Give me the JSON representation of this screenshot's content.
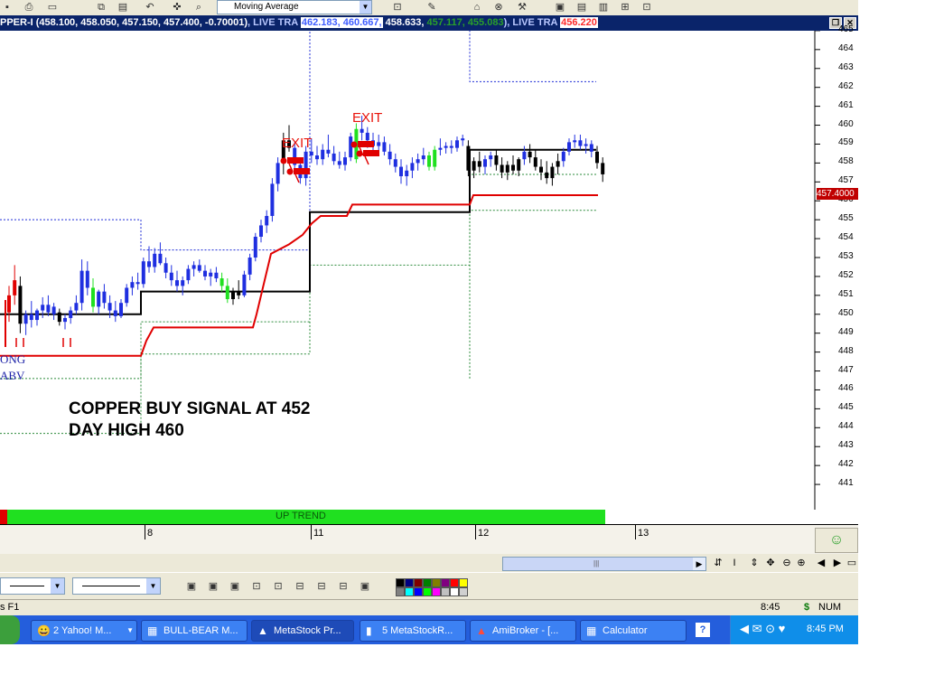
{
  "toolbar": {
    "indicator_value": "Moving Average",
    "buttons": [
      "save-icon",
      "print-icon",
      "copy-icon",
      "paste-icon",
      "undo-icon",
      "crosshair-icon",
      "zoom-icon"
    ],
    "right_buttons": [
      "tile-icon",
      "windows-icon",
      "split-icon",
      "grid-icon",
      "layout-icon"
    ]
  },
  "title_bar": {
    "prefix": "PPER-I",
    "ohlc": "(458.100, 458.050, 457.150, 457.400, -0.70001)",
    "sep1": ", LIVE TRA",
    "live1_a": "462.183, 460.667,",
    "live1_b": "458.633,",
    "live1_c": "457.117, 455.083",
    "sep2": "), LIVE TRA",
    "live2": "456.220",
    "colors": {
      "a": "#3d5cff",
      "b": "#ffffff",
      "c": "#2aa02a",
      "d": "#ff4a4a"
    }
  },
  "chart_data": {
    "type": "candlestick",
    "title": "COPPER BUY SIGNAL AT 452",
    "subtitle": "DAY HIGH 460",
    "annotations": [
      "EXIT",
      "EXIT"
    ],
    "left_text": [
      "ONG",
      "ABV"
    ],
    "ylim": [
      440.5,
      466.2
    ],
    "yticks": [
      441,
      442,
      443,
      444,
      445,
      446,
      447,
      448,
      449,
      450,
      451,
      452,
      453,
      454,
      455,
      456,
      457,
      458,
      459,
      460,
      461,
      462,
      463,
      464,
      465
    ],
    "last_price": "457.4000",
    "x_labels": [
      "8",
      "11",
      "12",
      "13"
    ],
    "candles": [
      [
        450.1,
        451.5,
        449.6,
        451.0,
        "r"
      ],
      [
        451.0,
        452.6,
        450.5,
        451.8,
        "r"
      ],
      [
        451.5,
        452.0,
        449.0,
        449.5,
        "k"
      ],
      [
        449.5,
        450.2,
        448.9,
        450.0,
        "b"
      ],
      [
        450.0,
        450.7,
        449.3,
        449.7,
        "b"
      ],
      [
        449.7,
        450.3,
        449.4,
        450.2,
        "b"
      ],
      [
        450.2,
        450.9,
        449.8,
        450.5,
        "b"
      ],
      [
        450.5,
        451.0,
        449.9,
        450.1,
        "b"
      ],
      [
        450.0,
        450.6,
        449.7,
        450.4,
        "b"
      ],
      [
        450.1,
        450.3,
        449.4,
        449.6,
        "k"
      ],
      [
        449.6,
        450.0,
        449.2,
        449.8,
        "b"
      ],
      [
        449.8,
        450.4,
        449.5,
        450.2,
        "b"
      ],
      [
        450.2,
        451.0,
        450.0,
        450.6,
        "b"
      ],
      [
        450.6,
        452.9,
        450.2,
        452.3,
        "b"
      ],
      [
        452.3,
        452.8,
        451.0,
        451.4,
        "b"
      ],
      [
        451.4,
        451.9,
        450.1,
        450.4,
        "g"
      ],
      [
        450.4,
        451.3,
        450.0,
        451.2,
        "b"
      ],
      [
        451.2,
        451.6,
        450.3,
        450.6,
        "b"
      ],
      [
        450.6,
        451.0,
        449.8,
        450.2,
        "b"
      ],
      [
        450.2,
        450.7,
        449.6,
        449.9,
        "b"
      ],
      [
        449.9,
        450.8,
        449.8,
        450.6,
        "b"
      ],
      [
        450.6,
        451.6,
        450.4,
        451.4,
        "b"
      ],
      [
        451.4,
        452.0,
        451.0,
        451.7,
        "b"
      ],
      [
        451.7,
        452.2,
        451.3,
        451.6,
        "b"
      ],
      [
        451.6,
        453.0,
        451.4,
        452.8,
        "b"
      ],
      [
        452.8,
        453.6,
        452.2,
        452.5,
        "b"
      ],
      [
        452.5,
        453.5,
        452.2,
        453.2,
        "b"
      ],
      [
        453.2,
        453.8,
        452.6,
        452.7,
        "b"
      ],
      [
        452.7,
        453.0,
        451.9,
        452.2,
        "b"
      ],
      [
        452.2,
        452.6,
        451.5,
        451.8,
        "b"
      ],
      [
        451.8,
        452.3,
        451.2,
        451.5,
        "b"
      ],
      [
        451.5,
        452.0,
        451.0,
        451.8,
        "b"
      ],
      [
        451.8,
        452.6,
        451.6,
        452.4,
        "b"
      ],
      [
        452.4,
        452.8,
        452.0,
        452.6,
        "b"
      ],
      [
        452.6,
        452.9,
        452.2,
        452.3,
        "b"
      ],
      [
        452.3,
        452.6,
        451.8,
        452.0,
        "b"
      ],
      [
        452.0,
        452.4,
        451.5,
        452.2,
        "b"
      ],
      [
        452.2,
        452.5,
        451.7,
        451.9,
        "b"
      ],
      [
        451.9,
        452.2,
        451.2,
        451.5,
        "g"
      ],
      [
        451.5,
        451.9,
        450.6,
        450.8,
        "g"
      ],
      [
        450.8,
        451.4,
        450.5,
        451.2,
        "k"
      ],
      [
        451.2,
        451.8,
        450.8,
        451.0,
        "k"
      ],
      [
        451.0,
        452.3,
        450.9,
        452.1,
        "b"
      ],
      [
        452.1,
        453.2,
        451.8,
        453.0,
        "b"
      ],
      [
        453.0,
        454.3,
        452.8,
        454.1,
        "b"
      ],
      [
        454.1,
        455.0,
        453.8,
        454.7,
        "b"
      ],
      [
        454.7,
        455.5,
        454.3,
        455.2,
        "b"
      ],
      [
        455.2,
        457.2,
        454.9,
        456.9,
        "b"
      ],
      [
        456.9,
        458.3,
        456.5,
        458.0,
        "b"
      ],
      [
        458.0,
        459.6,
        457.4,
        459.2,
        "k"
      ],
      [
        459.2,
        460.0,
        458.6,
        458.8,
        "k"
      ],
      [
        458.8,
        459.1,
        457.6,
        457.9,
        "b"
      ],
      [
        457.9,
        458.2,
        456.9,
        457.2,
        "b"
      ],
      [
        457.2,
        458.9,
        456.8,
        458.6,
        "b"
      ],
      [
        458.6,
        459.3,
        458.0,
        458.4,
        "b"
      ],
      [
        458.4,
        458.9,
        457.9,
        458.2,
        "b"
      ],
      [
        458.2,
        459.0,
        457.9,
        458.7,
        "b"
      ],
      [
        458.7,
        459.5,
        458.3,
        458.5,
        "b"
      ],
      [
        458.5,
        458.9,
        457.9,
        458.1,
        "b"
      ],
      [
        458.1,
        458.6,
        457.7,
        457.9,
        "b"
      ],
      [
        457.9,
        458.6,
        457.6,
        458.3,
        "b"
      ],
      [
        458.3,
        459.6,
        458.1,
        459.4,
        "b"
      ],
      [
        458.2,
        460.1,
        458.0,
        459.8,
        "g"
      ],
      [
        459.8,
        460.5,
        459.2,
        459.6,
        "b"
      ],
      [
        459.6,
        459.9,
        458.8,
        459.2,
        "b"
      ],
      [
        459.2,
        459.6,
        458.6,
        458.9,
        "b"
      ],
      [
        458.9,
        459.5,
        458.5,
        459.1,
        "b"
      ],
      [
        459.1,
        459.4,
        458.4,
        458.6,
        "b"
      ],
      [
        458.6,
        459.0,
        457.9,
        458.2,
        "b"
      ],
      [
        458.2,
        458.5,
        457.5,
        457.8,
        "b"
      ],
      [
        457.8,
        458.2,
        456.9,
        457.3,
        "b"
      ],
      [
        457.3,
        457.9,
        456.8,
        457.6,
        "b"
      ],
      [
        457.6,
        458.3,
        457.2,
        458.0,
        "b"
      ],
      [
        458.0,
        458.5,
        457.6,
        458.2,
        "b"
      ],
      [
        458.2,
        458.8,
        457.9,
        458.4,
        "b"
      ],
      [
        458.4,
        458.6,
        457.6,
        457.8,
        "g"
      ],
      [
        457.8,
        458.9,
        457.6,
        458.7,
        "g"
      ],
      [
        458.7,
        459.3,
        458.4,
        458.8,
        "b"
      ],
      [
        458.8,
        459.1,
        458.5,
        458.9,
        "b"
      ],
      [
        458.9,
        459.2,
        458.5,
        458.8,
        "b"
      ],
      [
        458.8,
        459.4,
        458.6,
        459.2,
        "b"
      ],
      [
        459.2,
        459.5,
        458.9,
        459.3,
        "b"
      ],
      [
        458.9,
        459.2,
        457.3,
        457.6,
        "k"
      ],
      [
        457.6,
        458.3,
        457.2,
        458.1,
        "k"
      ],
      [
        458.1,
        458.6,
        457.5,
        457.8,
        "k"
      ],
      [
        457.8,
        458.4,
        457.4,
        458.2,
        "b"
      ],
      [
        458.2,
        458.6,
        457.8,
        458.4,
        "b"
      ],
      [
        458.4,
        458.7,
        457.6,
        457.9,
        "k"
      ],
      [
        457.9,
        458.3,
        457.2,
        457.5,
        "k"
      ],
      [
        457.5,
        458.1,
        457.1,
        457.9,
        "k"
      ],
      [
        457.9,
        458.4,
        457.4,
        457.6,
        "k"
      ],
      [
        457.6,
        458.3,
        457.3,
        458.2,
        "k"
      ],
      [
        458.2,
        458.9,
        457.9,
        458.6,
        "b"
      ],
      [
        458.6,
        459.0,
        458.0,
        458.3,
        "k"
      ],
      [
        458.3,
        458.7,
        457.6,
        457.8,
        "k"
      ],
      [
        457.8,
        458.2,
        457.1,
        457.5,
        "k"
      ],
      [
        457.5,
        458.1,
        456.9,
        457.2,
        "k"
      ],
      [
        457.2,
        458.0,
        456.8,
        457.8,
        "k"
      ],
      [
        457.8,
        458.5,
        457.4,
        458.1,
        "k"
      ],
      [
        458.1,
        458.8,
        457.8,
        458.6,
        "b"
      ],
      [
        458.6,
        459.3,
        458.4,
        459.1,
        "b"
      ],
      [
        459.1,
        459.5,
        458.8,
        459.2,
        "b"
      ],
      [
        459.2,
        459.5,
        458.7,
        458.9,
        "b"
      ],
      [
        458.9,
        459.3,
        458.5,
        459.0,
        "b"
      ],
      [
        459.0,
        459.2,
        458.3,
        458.6,
        "b"
      ],
      [
        458.6,
        458.9,
        457.7,
        458.0,
        "k"
      ],
      [
        458.0,
        458.3,
        457.0,
        457.4,
        "k"
      ]
    ]
  },
  "trend": {
    "label": "UP TREND"
  },
  "nav_buttons": [
    "refresh-icon",
    "cursor-icon",
    "move-icon",
    "zoom-out-icon",
    "zoom-in-icon",
    "prev-icon",
    "next-icon",
    "maximize-icon"
  ],
  "status": {
    "left": "s F1",
    "time": "8:45",
    "currency": "$",
    "num": "NUM"
  },
  "taskbar": {
    "items": [
      {
        "label": "2 Yahoo! M...",
        "icon": "😀"
      },
      {
        "label": "BULL-BEAR M...",
        "icon": "▦"
      },
      {
        "label": "MetaStock Pr...",
        "icon": "▲"
      },
      {
        "label": "5 MetaStockR...",
        "icon": "▮"
      },
      {
        "label": "AmiBroker - [...",
        "icon": "▲"
      },
      {
        "label": "Calculator",
        "icon": "▦"
      }
    ],
    "help": "?",
    "clock": "8:45 PM"
  }
}
